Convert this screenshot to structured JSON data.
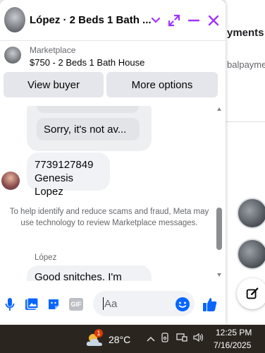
{
  "background": {
    "payments_fragment": "yments",
    "balpay_fragment": "balpayme"
  },
  "chat": {
    "title": "López · 2 Beds 1 Bath ...",
    "accent_color": "#a033ff",
    "marketplace": {
      "label": "Marketplace",
      "listing": "$750 - 2 Beds 1 Bath House",
      "buttons": [
        "View buyer",
        "More options"
      ]
    },
    "messages": {
      "quick_reply_partial": "Sorry, it's not av...",
      "phone_line1": "7739127849",
      "phone_line2": "Genesis Lopez",
      "notice": "To help identify and reduce scams and fraud, Meta may use technology to review Marketplace messages.",
      "sender": "López",
      "last_message": "Good snitches. I'm"
    },
    "composer": {
      "placeholder": "Aa",
      "gif_label": "GIF"
    }
  },
  "taskbar": {
    "temperature": "28°C",
    "weather_badge": "1",
    "time": "12:25 PM",
    "date": "7/16/2025"
  }
}
